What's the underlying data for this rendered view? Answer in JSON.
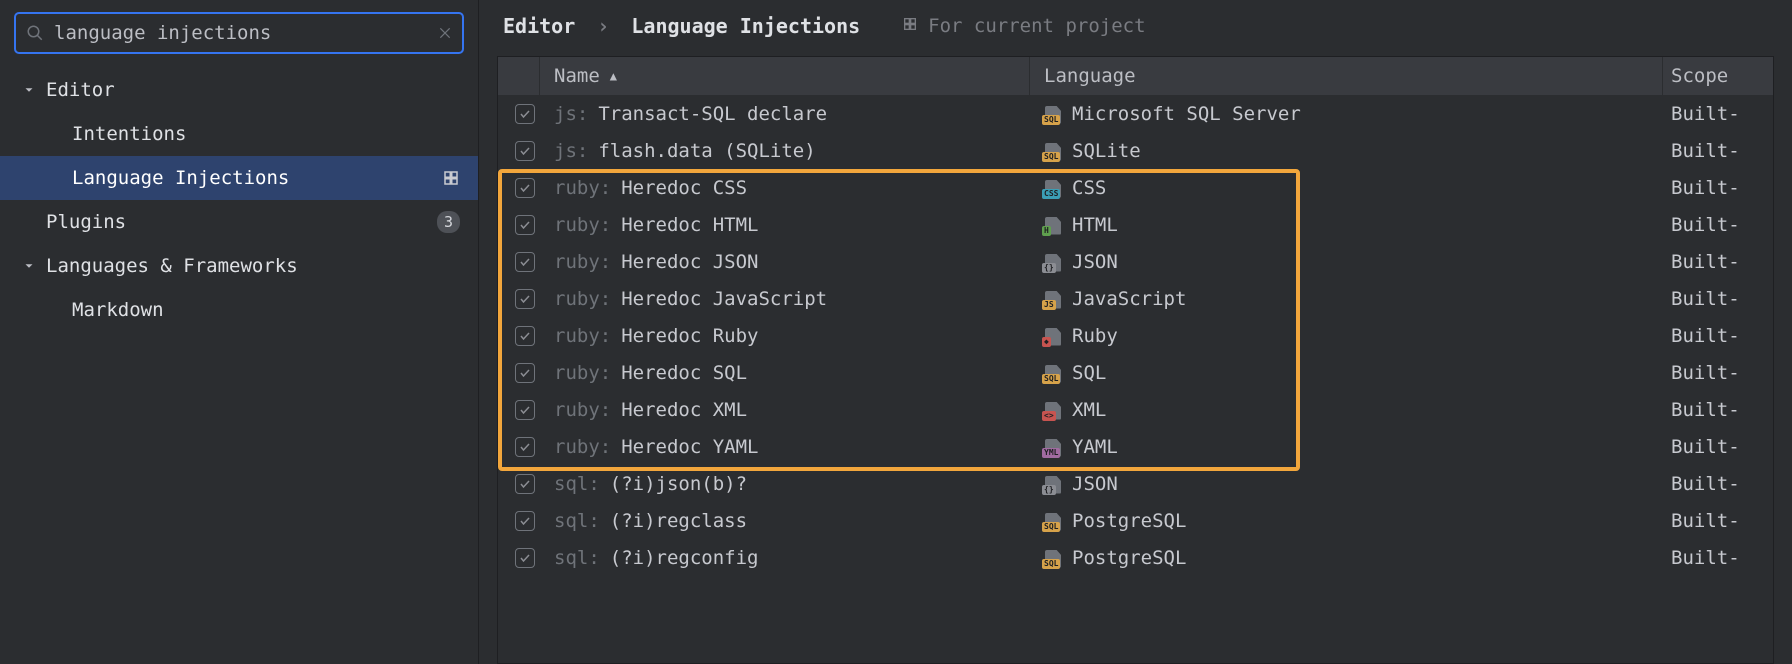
{
  "search": {
    "value": "language injections"
  },
  "sidebar": {
    "items": [
      {
        "label": "Editor",
        "expandable": true
      },
      {
        "label": "Intentions"
      },
      {
        "label": "Language Injections",
        "selected": true,
        "badge_icon": "project"
      },
      {
        "label": "Plugins",
        "count": "3"
      },
      {
        "label": "Languages & Frameworks",
        "expandable": true
      },
      {
        "label": "Markdown"
      }
    ]
  },
  "breadcrumb": {
    "parent": "Editor",
    "sep": "›",
    "current": "Language Injections"
  },
  "scope_hint": "For current project",
  "table": {
    "headers": {
      "name": "Name",
      "language": "Language",
      "scope": "Scope"
    },
    "rows": [
      {
        "prefix": "js:",
        "name": "Transact-SQL declare",
        "lang": "Microsoft SQL Server",
        "icon_tag": "SQL",
        "icon_color": "#d6a24a",
        "scope": "Built-"
      },
      {
        "prefix": "js:",
        "name": "flash.data (SQLite)",
        "lang": "SQLite",
        "icon_tag": "SQL",
        "icon_color": "#d6a24a",
        "scope": "Built-"
      },
      {
        "prefix": "ruby:",
        "name": "Heredoc CSS",
        "lang": "CSS",
        "icon_tag": "CSS",
        "icon_color": "#3b9eb5",
        "scope": "Built-"
      },
      {
        "prefix": "ruby:",
        "name": "Heredoc HTML",
        "lang": "HTML",
        "icon_tag": "H",
        "icon_color": "#5fa04e",
        "scope": "Built-"
      },
      {
        "prefix": "ruby:",
        "name": "Heredoc JSON",
        "lang": "JSON",
        "icon_tag": "{}",
        "icon_color": "#8b8d93",
        "scope": "Built-"
      },
      {
        "prefix": "ruby:",
        "name": "Heredoc JavaScript",
        "lang": "JavaScript",
        "icon_tag": "JS",
        "icon_color": "#d6a24a",
        "scope": "Built-"
      },
      {
        "prefix": "ruby:",
        "name": "Heredoc Ruby",
        "lang": "Ruby",
        "icon_tag": "◆",
        "icon_color": "#c75450",
        "scope": "Built-"
      },
      {
        "prefix": "ruby:",
        "name": "Heredoc SQL",
        "lang": "SQL",
        "icon_tag": "SQL",
        "icon_color": "#d6a24a",
        "scope": "Built-"
      },
      {
        "prefix": "ruby:",
        "name": "Heredoc XML",
        "lang": "XML",
        "icon_tag": "<>",
        "icon_color": "#c75450",
        "scope": "Built-"
      },
      {
        "prefix": "ruby:",
        "name": "Heredoc YAML",
        "lang": "YAML",
        "icon_tag": "YML",
        "icon_color": "#a16ba1",
        "scope": "Built-"
      },
      {
        "prefix": "sql:",
        "name": "(?i)json(b)?",
        "lang": "JSON",
        "icon_tag": "{}",
        "icon_color": "#8b8d93",
        "scope": "Built-"
      },
      {
        "prefix": "sql:",
        "name": "(?i)regclass",
        "lang": "PostgreSQL",
        "icon_tag": "SQL",
        "icon_color": "#d6a24a",
        "scope": "Built-"
      },
      {
        "prefix": "sql:",
        "name": "(?i)regconfig",
        "lang": "PostgreSQL",
        "icon_tag": "SQL",
        "icon_color": "#d6a24a",
        "scope": "Built-"
      }
    ]
  }
}
